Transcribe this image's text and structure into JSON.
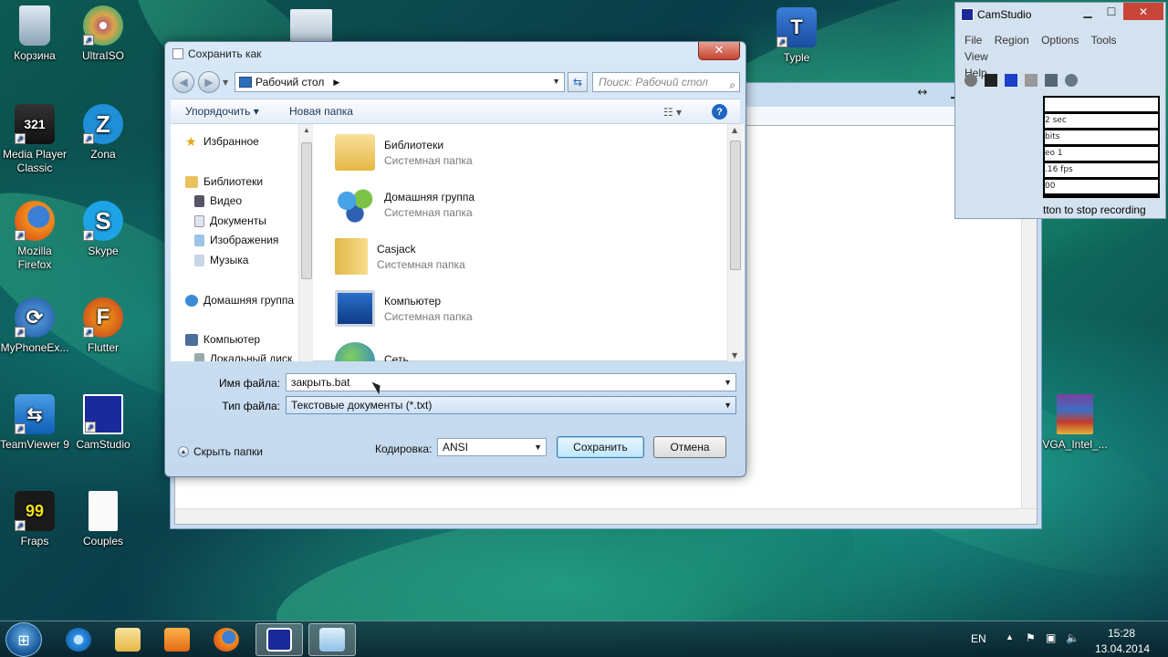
{
  "desktop": {
    "icons": [
      {
        "label": "Корзина"
      },
      {
        "label": "UltraISO"
      },
      {
        "label": "Media Player Classic"
      },
      {
        "label": "Zona"
      },
      {
        "label": "Mozilla Firefox"
      },
      {
        "label": "Skype"
      },
      {
        "label": "MyPhoneEx..."
      },
      {
        "label": "Flutter"
      },
      {
        "label": "TeamViewer 9"
      },
      {
        "label": "CamStudio"
      },
      {
        "label": "Fraps"
      },
      {
        "label": "Couples"
      },
      {
        "label": "Typle"
      },
      {
        "label": "VGA_Intel_..."
      }
    ]
  },
  "camstudio": {
    "title": "CamStudio",
    "menu": [
      "File",
      "Region",
      "Options",
      "Tools",
      "View",
      "Help"
    ],
    "stats": [
      "",
      "2 sec",
      "bits",
      "eo 1",
      ".16 fps",
      "00"
    ],
    "stop_text": "tton to stop recording"
  },
  "dialog": {
    "title": "Сохранить как",
    "address": "Рабочий стол",
    "search_placeholder": "Поиск: Рабочий стол",
    "toolbar": {
      "organize": "Упорядочить",
      "new_folder": "Новая папка"
    },
    "nav": [
      {
        "label": "Избранное"
      },
      {
        "label": "Библиотеки"
      },
      {
        "label": "Видео"
      },
      {
        "label": "Документы"
      },
      {
        "label": "Изображения"
      },
      {
        "label": "Музыка"
      },
      {
        "label": "Домашняя группа"
      },
      {
        "label": "Компьютер"
      },
      {
        "label": "Локальный диск"
      }
    ],
    "files": [
      {
        "name": "Библиотеки",
        "type": "Системная папка"
      },
      {
        "name": "Домашняя группа",
        "type": "Системная папка"
      },
      {
        "name": "Casjack",
        "type": "Системная папка"
      },
      {
        "name": "Компьютер",
        "type": "Системная папка"
      },
      {
        "name": "Сеть",
        "type": ""
      }
    ],
    "filename_label": "Имя файла:",
    "filename_value": "закрыть.bat",
    "filetype_label": "Тип файла:",
    "filetype_value": "Текстовые документы (*.txt)",
    "hide_folders": "Скрыть папки",
    "encoding_label": "Кодировка:",
    "encoding_value": "ANSI",
    "save_button": "Сохранить",
    "cancel_button": "Отмена"
  },
  "taskbar": {
    "language": "EN",
    "time": "15:28",
    "date": "13.04.2014"
  },
  "colors": {
    "dialog_accent": "#1f66c2",
    "close_red": "#c7432f",
    "wallpaper": "#0d5a52"
  }
}
